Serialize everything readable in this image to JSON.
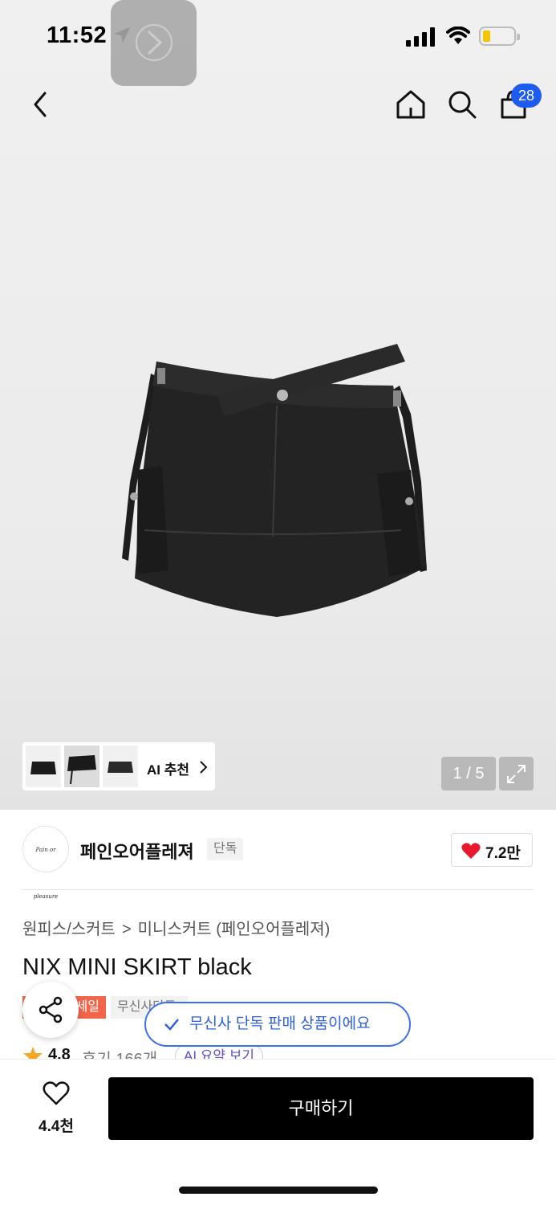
{
  "status_bar": {
    "time": "11:52"
  },
  "header": {
    "cart_count": "28"
  },
  "gallery": {
    "ai_recommend_label": "AI 추천",
    "counter": "1 / 5"
  },
  "store": {
    "logo_text": "Pain or pleasure",
    "name": "페인오어플레져",
    "exclusive_tag": "단독",
    "likes": "7.2만"
  },
  "breadcrumb": {
    "category": "원피스/스커트",
    "separator": ">",
    "subcategory": "미니스커트 (페인오어플레져)"
  },
  "product": {
    "title": "NIX MINI SKIRT black",
    "sale_tag": "세일",
    "musinsa_tag": "무신사단독",
    "rating": "4.8",
    "reviews": "후기 166개",
    "ai_summary": "AI 요약 보기"
  },
  "toast": {
    "message": "무신사 단독 판매 상품이에요"
  },
  "bottom_bar": {
    "wish_count": "4.4천",
    "buy_label": "구매하기"
  },
  "colors": {
    "accent_blue": "#1e5bf0",
    "sale_red": "#f3654a",
    "heart_red": "#e8192c",
    "button_black": "#000000"
  }
}
